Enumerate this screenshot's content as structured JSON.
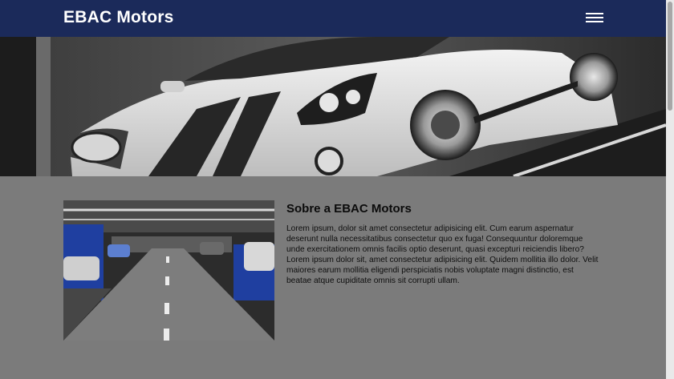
{
  "header": {
    "brand": "EBAC Motors",
    "menu_icon": "hamburger-menu-icon"
  },
  "hero": {
    "image": "white-sports-car-photo"
  },
  "about": {
    "image": "parking-garage-photo",
    "title": "Sobre a EBAC Motors",
    "text": "Lorem ipsum, dolor sit amet consectetur adipisicing elit. Cum earum aspernatur deserunt nulla necessitatibus consectetur quo ex fuga! Consequuntur doloremque unde exercitationem omnis facilis optio deserunt, quasi excepturi reiciendis libero? Lorem ipsum dolor sit, amet consectetur adipisicing elit. Quidem mollitia illo dolor. Velit maiores earum mollitia eligendi perspiciatis nobis voluptate magni distinctio, est beatae atque cupiditate omnis sit corrupti ullam."
  },
  "colors": {
    "header_bg": "#1b2a5a",
    "page_bg": "#7b7b7b",
    "brand_text": "#ffffff"
  }
}
